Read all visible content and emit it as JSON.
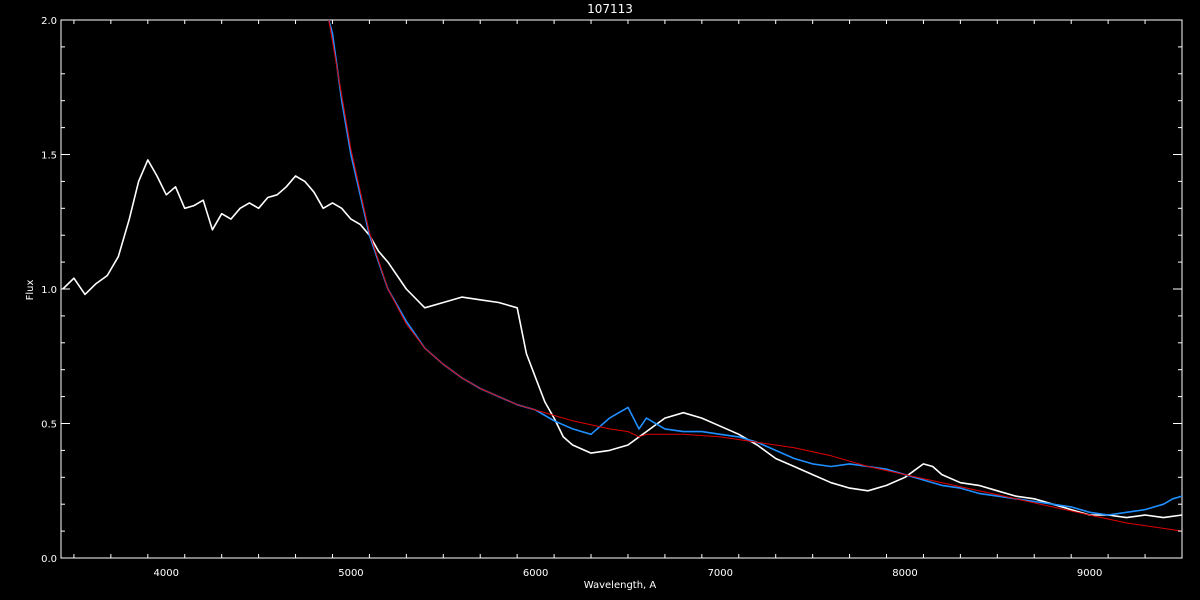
{
  "chart_data": {
    "type": "line",
    "title": "107113",
    "xlabel": "Wavelength, A",
    "ylabel": "Flux",
    "xlim": [
      3430,
      9500
    ],
    "ylim": [
      0.0,
      2.0
    ],
    "xticks": [
      4000,
      5000,
      6000,
      7000,
      8000,
      9000
    ],
    "xtick_labels": [
      "4000",
      "5000",
      "6000",
      "7000",
      "8000",
      "9000"
    ],
    "yticks": [
      0.0,
      0.5,
      1.0,
      1.5,
      2.0
    ],
    "ytick_labels": [
      "0.0",
      "0.5",
      "1.0",
      "1.5",
      "2.0"
    ],
    "grid": false,
    "background": "#000000",
    "series": [
      {
        "color": "#ffffff",
        "x": [
          3440,
          3500,
          3560,
          3620,
          3680,
          3740,
          3800,
          3850,
          3900,
          3950,
          4000,
          4050,
          4100,
          4150,
          4200,
          4250,
          4300,
          4350,
          4400,
          4450,
          4500,
          4550,
          4600,
          4650,
          4700,
          4750,
          4800,
          4850,
          4900,
          4950,
          5000,
          5050,
          5100,
          5150,
          5200,
          5300,
          5400,
          5500,
          5600,
          5700,
          5800,
          5900,
          5950,
          6000,
          6050,
          6100,
          6150,
          6200,
          6300,
          6400,
          6500,
          6600,
          6700,
          6800,
          6900,
          7000,
          7100,
          7200,
          7300,
          7400,
          7500,
          7600,
          7700,
          7800,
          7900,
          8000,
          8100,
          8150,
          8200,
          8300,
          8400,
          8500,
          8600,
          8700,
          8800,
          8900,
          9000,
          9100,
          9200,
          9300,
          9400,
          9500
        ],
        "y": [
          1.0,
          1.04,
          0.98,
          1.02,
          1.05,
          1.12,
          1.26,
          1.4,
          1.48,
          1.42,
          1.35,
          1.38,
          1.3,
          1.31,
          1.33,
          1.22,
          1.28,
          1.26,
          1.3,
          1.32,
          1.3,
          1.34,
          1.35,
          1.38,
          1.42,
          1.4,
          1.36,
          1.3,
          1.32,
          1.3,
          1.26,
          1.24,
          1.2,
          1.14,
          1.1,
          1.0,
          0.93,
          0.95,
          0.97,
          0.96,
          0.95,
          0.93,
          0.76,
          0.67,
          0.58,
          0.52,
          0.45,
          0.42,
          0.39,
          0.4,
          0.42,
          0.47,
          0.52,
          0.54,
          0.52,
          0.49,
          0.46,
          0.42,
          0.37,
          0.34,
          0.31,
          0.28,
          0.26,
          0.25,
          0.27,
          0.3,
          0.35,
          0.34,
          0.31,
          0.28,
          0.27,
          0.25,
          0.23,
          0.22,
          0.2,
          0.18,
          0.16,
          0.16,
          0.15,
          0.16,
          0.15,
          0.16
        ]
      },
      {
        "color": "#1f8fff",
        "x": [
          4880,
          4900,
          4950,
          5000,
          5050,
          5100,
          5150,
          5200,
          5300,
          5400,
          5500,
          5600,
          5700,
          5800,
          5900,
          6000,
          6100,
          6200,
          6300,
          6400,
          6500,
          6560,
          6600,
          6700,
          6800,
          6900,
          7000,
          7100,
          7200,
          7300,
          7400,
          7500,
          7600,
          7700,
          7800,
          7900,
          8000,
          8100,
          8200,
          8300,
          8400,
          8500,
          8600,
          8700,
          8800,
          8900,
          9000,
          9100,
          9200,
          9300,
          9400,
          9450,
          9500
        ],
        "y": [
          2.0,
          1.95,
          1.7,
          1.5,
          1.35,
          1.2,
          1.1,
          1.0,
          0.88,
          0.78,
          0.72,
          0.67,
          0.63,
          0.6,
          0.57,
          0.55,
          0.51,
          0.48,
          0.46,
          0.52,
          0.56,
          0.48,
          0.52,
          0.48,
          0.47,
          0.47,
          0.46,
          0.45,
          0.43,
          0.4,
          0.37,
          0.35,
          0.34,
          0.35,
          0.34,
          0.33,
          0.31,
          0.29,
          0.27,
          0.26,
          0.24,
          0.23,
          0.22,
          0.21,
          0.2,
          0.19,
          0.17,
          0.16,
          0.17,
          0.18,
          0.2,
          0.22,
          0.23
        ]
      },
      {
        "color": "#e00000",
        "x": [
          4880,
          4950,
          5000,
          5100,
          5200,
          5300,
          5400,
          5500,
          5600,
          5700,
          5800,
          5900,
          6000,
          6200,
          6400,
          6500,
          6560,
          6600,
          6800,
          7000,
          7200,
          7400,
          7600,
          7800,
          8000,
          8200,
          8400,
          8600,
          8800,
          9000,
          9200,
          9400,
          9500
        ],
        "y": [
          2.0,
          1.72,
          1.52,
          1.21,
          1.0,
          0.87,
          0.78,
          0.72,
          0.67,
          0.63,
          0.6,
          0.57,
          0.55,
          0.51,
          0.48,
          0.47,
          0.45,
          0.46,
          0.46,
          0.45,
          0.43,
          0.41,
          0.38,
          0.34,
          0.31,
          0.28,
          0.25,
          0.22,
          0.19,
          0.16,
          0.13,
          0.11,
          0.1
        ]
      }
    ]
  }
}
